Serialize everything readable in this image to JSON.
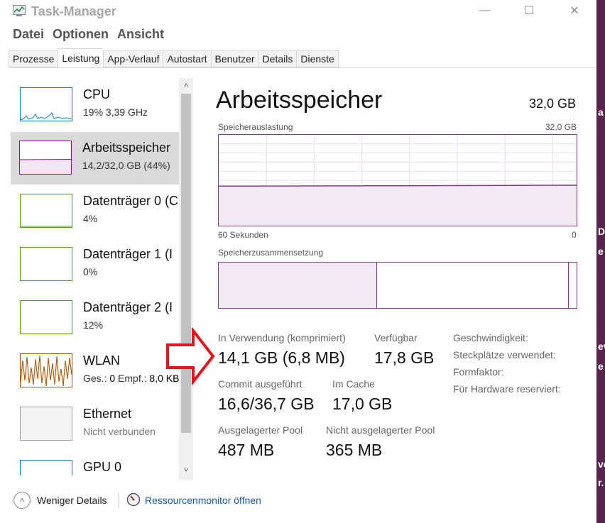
{
  "window": {
    "title": "Task-Manager",
    "controls": {
      "minimize": "—",
      "maximize": "☐",
      "close": "✕"
    }
  },
  "menu": [
    "Datei",
    "Optionen",
    "Ansicht"
  ],
  "tabs": [
    "Prozesse",
    "Leistung",
    "App-Verlauf",
    "Autostart",
    "Benutzer",
    "Details",
    "Dienste"
  ],
  "active_tab": "Leistung",
  "sidebar": {
    "items": [
      {
        "name": "CPU",
        "sub": "19%  3,39 GHz",
        "color": "#117dbb"
      },
      {
        "name": "Arbeitsspeicher",
        "sub": "14,2/32,0 GB (44%)",
        "color": "#8b12ae",
        "selected": true
      },
      {
        "name": "Datenträger 0 (C",
        "sub": "4%",
        "color": "#4da60c"
      },
      {
        "name": "Datenträger 1 (I",
        "sub": "0%",
        "color": "#4da60c"
      },
      {
        "name": "Datenträger 2 (I",
        "sub": "12%",
        "color": "#4da60c"
      },
      {
        "name": "WLAN",
        "sub_label_send": "Ges.:",
        "sub_val_send": "0",
        "sub_label_recv": "Empf.:",
        "sub_val_recv": "8,0 KB",
        "color": "#a74f01"
      },
      {
        "name": "Ethernet",
        "sub": "Nicht verbunden",
        "color": "#a0a0a0"
      },
      {
        "name": "GPU 0",
        "sub": "",
        "color": "#117dbb"
      }
    ]
  },
  "memory": {
    "title": "Arbeitsspeicher",
    "total": "32,0 GB",
    "usage_label": "Speicherauslastung",
    "usage_max": "32,0 GB",
    "time_left": "60 Sekunden",
    "time_right": "0",
    "usage_fraction": 0.44,
    "composition_label": "Speicherzusammensetzung",
    "composition_in_use_fraction": 0.44,
    "stats": {
      "in_use_label": "In Verwendung (komprimiert)",
      "in_use_value": "14,1 GB (6,8 MB)",
      "available_label": "Verfügbar",
      "available_value": "17,8 GB",
      "committed_label": "Commit ausgeführt",
      "committed_value": "16,6/36,7 GB",
      "cached_label": "Im Cache",
      "cached_value": "17,0 GB",
      "paged_label": "Ausgelagerter Pool",
      "paged_value": "487 MB",
      "nonpaged_label": "Nicht ausgelagerter Pool",
      "nonpaged_value": "365 MB"
    },
    "meta": {
      "speed_label": "Geschwindigkeit:",
      "slots_label": "Steckplätze verwendet:",
      "form_label": "Formfaktor:",
      "reserved_label": "Für Hardware reserviert:"
    }
  },
  "footer": {
    "fewer_details": "Weniger Details",
    "resource_monitor": "Ressourcenmonitor öffnen"
  },
  "desktop_fragments": [
    "a",
    "D",
    "e",
    "ev",
    "e",
    "vo",
    "r."
  ],
  "colors": {
    "memory_accent": "#8b3a8b",
    "arrow": "#e8141b",
    "link": "#1a5ca8"
  }
}
